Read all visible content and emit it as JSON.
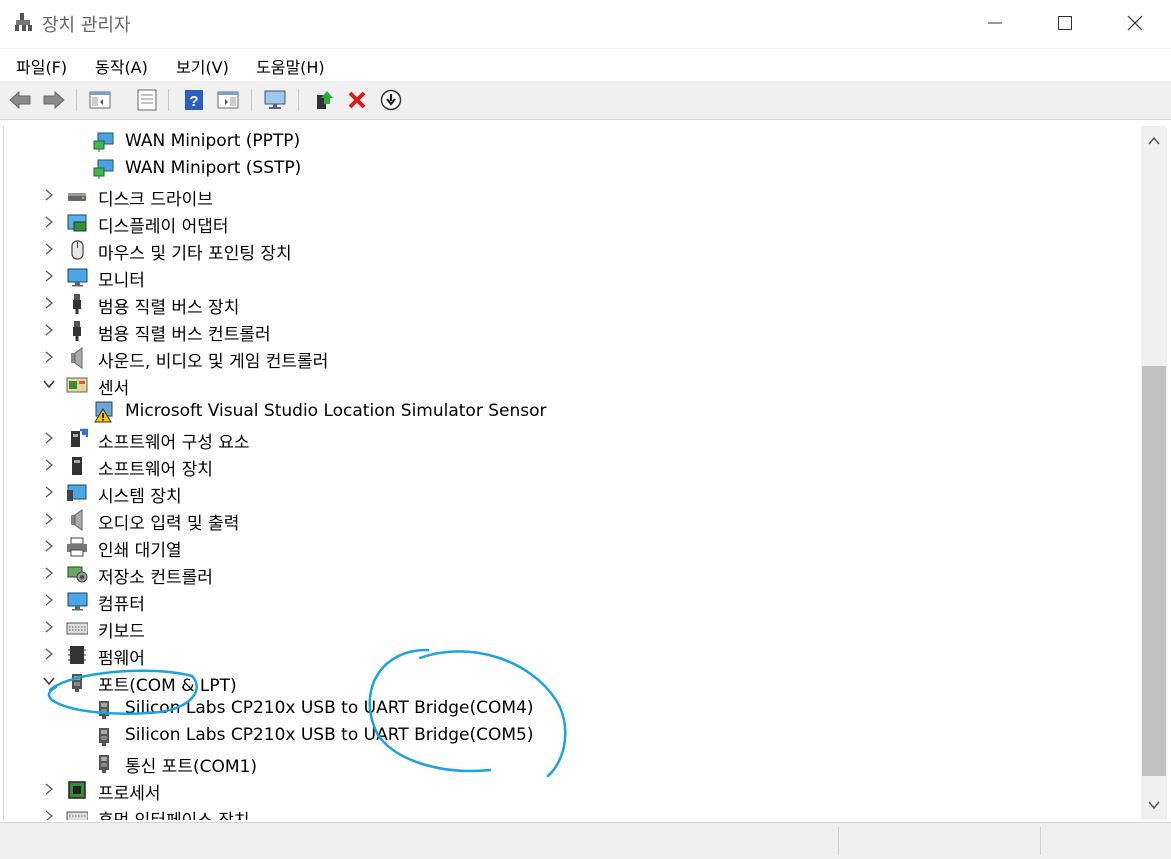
{
  "window": {
    "title": "장치 관리자",
    "minimize_icon": "minimize-icon",
    "maximize_icon": "maximize-icon",
    "close_icon": "close-icon"
  },
  "menu": {
    "items": [
      "파일(F)",
      "동작(A)",
      "보기(V)",
      "도움말(H)"
    ]
  },
  "toolbar": {
    "icons": [
      "back-arrow-icon",
      "forward-arrow-icon",
      "show-hide-console-tree-icon",
      "properties-icon",
      "help-icon",
      "action-pane-icon",
      "scan-hardware-icon",
      "update-driver-icon",
      "uninstall-device-icon",
      "disable-device-icon"
    ]
  },
  "tree": {
    "rows": [
      {
        "label": "WAN Miniport (PPTP)",
        "level": 1,
        "icon": "network-adapter-icon"
      },
      {
        "label": "WAN Miniport (SSTP)",
        "level": 1,
        "icon": "network-adapter-icon"
      },
      {
        "label": "디스크 드라이브",
        "level": 0,
        "expanded": false,
        "icon": "disk-drive-icon"
      },
      {
        "label": "디스플레이 어댑터",
        "level": 0,
        "expanded": false,
        "icon": "display-adapter-icon"
      },
      {
        "label": "마우스 및 기타 포인팅 장치",
        "level": 0,
        "expanded": false,
        "icon": "mouse-icon"
      },
      {
        "label": "모니터",
        "level": 0,
        "expanded": false,
        "icon": "monitor-icon"
      },
      {
        "label": "범용 직렬 버스 장치",
        "level": 0,
        "expanded": false,
        "icon": "usb-icon"
      },
      {
        "label": "범용 직렬 버스 컨트롤러",
        "level": 0,
        "expanded": false,
        "icon": "usb-icon"
      },
      {
        "label": "사운드, 비디오 및 게임 컨트롤러",
        "level": 0,
        "expanded": false,
        "icon": "speaker-icon"
      },
      {
        "label": "센서",
        "level": 0,
        "expanded": true,
        "icon": "sensor-icon"
      },
      {
        "label": "Microsoft Visual Studio Location Simulator Sensor",
        "level": 1,
        "icon": "sensor-warning-icon"
      },
      {
        "label": "소프트웨어 구성 요소",
        "level": 0,
        "expanded": false,
        "icon": "software-component-icon"
      },
      {
        "label": "소프트웨어 장치",
        "level": 0,
        "expanded": false,
        "icon": "software-device-icon"
      },
      {
        "label": "시스템 장치",
        "level": 0,
        "expanded": false,
        "icon": "system-device-icon"
      },
      {
        "label": "오디오 입력 및 출력",
        "level": 0,
        "expanded": false,
        "icon": "speaker-icon"
      },
      {
        "label": "인쇄 대기열",
        "level": 0,
        "expanded": false,
        "icon": "printer-icon"
      },
      {
        "label": "저장소 컨트롤러",
        "level": 0,
        "expanded": false,
        "icon": "storage-controller-icon"
      },
      {
        "label": "컴퓨터",
        "level": 0,
        "expanded": false,
        "icon": "monitor-icon"
      },
      {
        "label": "키보드",
        "level": 0,
        "expanded": false,
        "icon": "keyboard-icon"
      },
      {
        "label": "펌웨어",
        "level": 0,
        "expanded": false,
        "icon": "firmware-icon"
      },
      {
        "label": "포트(COM & LPT)",
        "level": 0,
        "expanded": true,
        "icon": "port-icon"
      },
      {
        "label": "Silicon Labs CP210x USB to UART Bridge(COM4)",
        "level": 1,
        "icon": "port-icon"
      },
      {
        "label": "Silicon Labs CP210x USB to UART Bridge(COM5)",
        "level": 1,
        "icon": "port-icon"
      },
      {
        "label": "통신 포트(COM1)",
        "level": 1,
        "icon": "port-icon"
      },
      {
        "label": "프로세서",
        "level": 0,
        "expanded": false,
        "icon": "processor-icon"
      },
      {
        "label": "휴먼 인터페이스 장치",
        "level": 0,
        "expanded": false,
        "icon": "hid-icon"
      }
    ]
  },
  "annotation": {
    "color": "#1aa3e0"
  }
}
